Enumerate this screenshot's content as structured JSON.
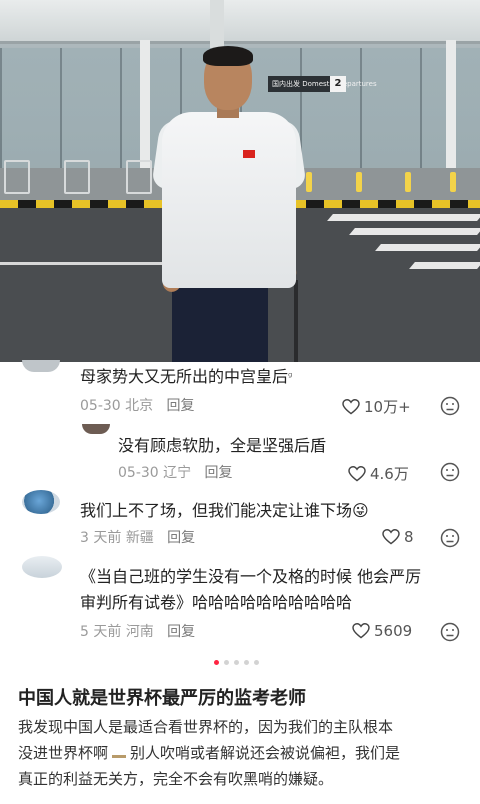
{
  "photo": {
    "description_icon": "photo",
    "sign_text": "国内出发 Domestic Departures",
    "sign_number": "2"
  },
  "comments": [
    {
      "text": "母家势大又无所出的中宫皇后",
      "text_suffix": "ᵍ",
      "date": "05-30",
      "location": "北京",
      "reply": "回复",
      "likes": "10万+"
    },
    {
      "text": "没有顾虑软肋，全是坚强后盾",
      "date": "05-30",
      "location": "辽宁",
      "reply": "回复",
      "likes": "4.6万"
    },
    {
      "text": "我们上不了场，但我们能决定让谁下场",
      "emoji": "😜",
      "date": "3 天前",
      "location": "新疆",
      "reply": "回复",
      "likes": "8"
    },
    {
      "text_line1": "《当自己班的学生没有一个及格的时候 他会严厉",
      "text_line2": "审判所有试卷》哈哈哈哈哈哈哈哈哈哈",
      "date": "5 天前",
      "location": "河南",
      "reply": "回复",
      "likes": "5609"
    }
  ],
  "pagination": {
    "total": 5,
    "active": 0
  },
  "note": {
    "title": "中国人就是世界杯最严厉的监考老师",
    "body_line1": "我发现中国人是最适合看世界杯的，因为我们的主队根本",
    "body_line2": "没进世界杯啊",
    "body_line2_rest": "别人吹哨或者解说还会被说偏袒，我们是",
    "body_line3": "真正的利益无关方，完全不会有吹黑哨的嫌疑。"
  },
  "colors": {
    "accent": "#ff2442",
    "meta": "#9a9a9a",
    "text": "#222222"
  }
}
